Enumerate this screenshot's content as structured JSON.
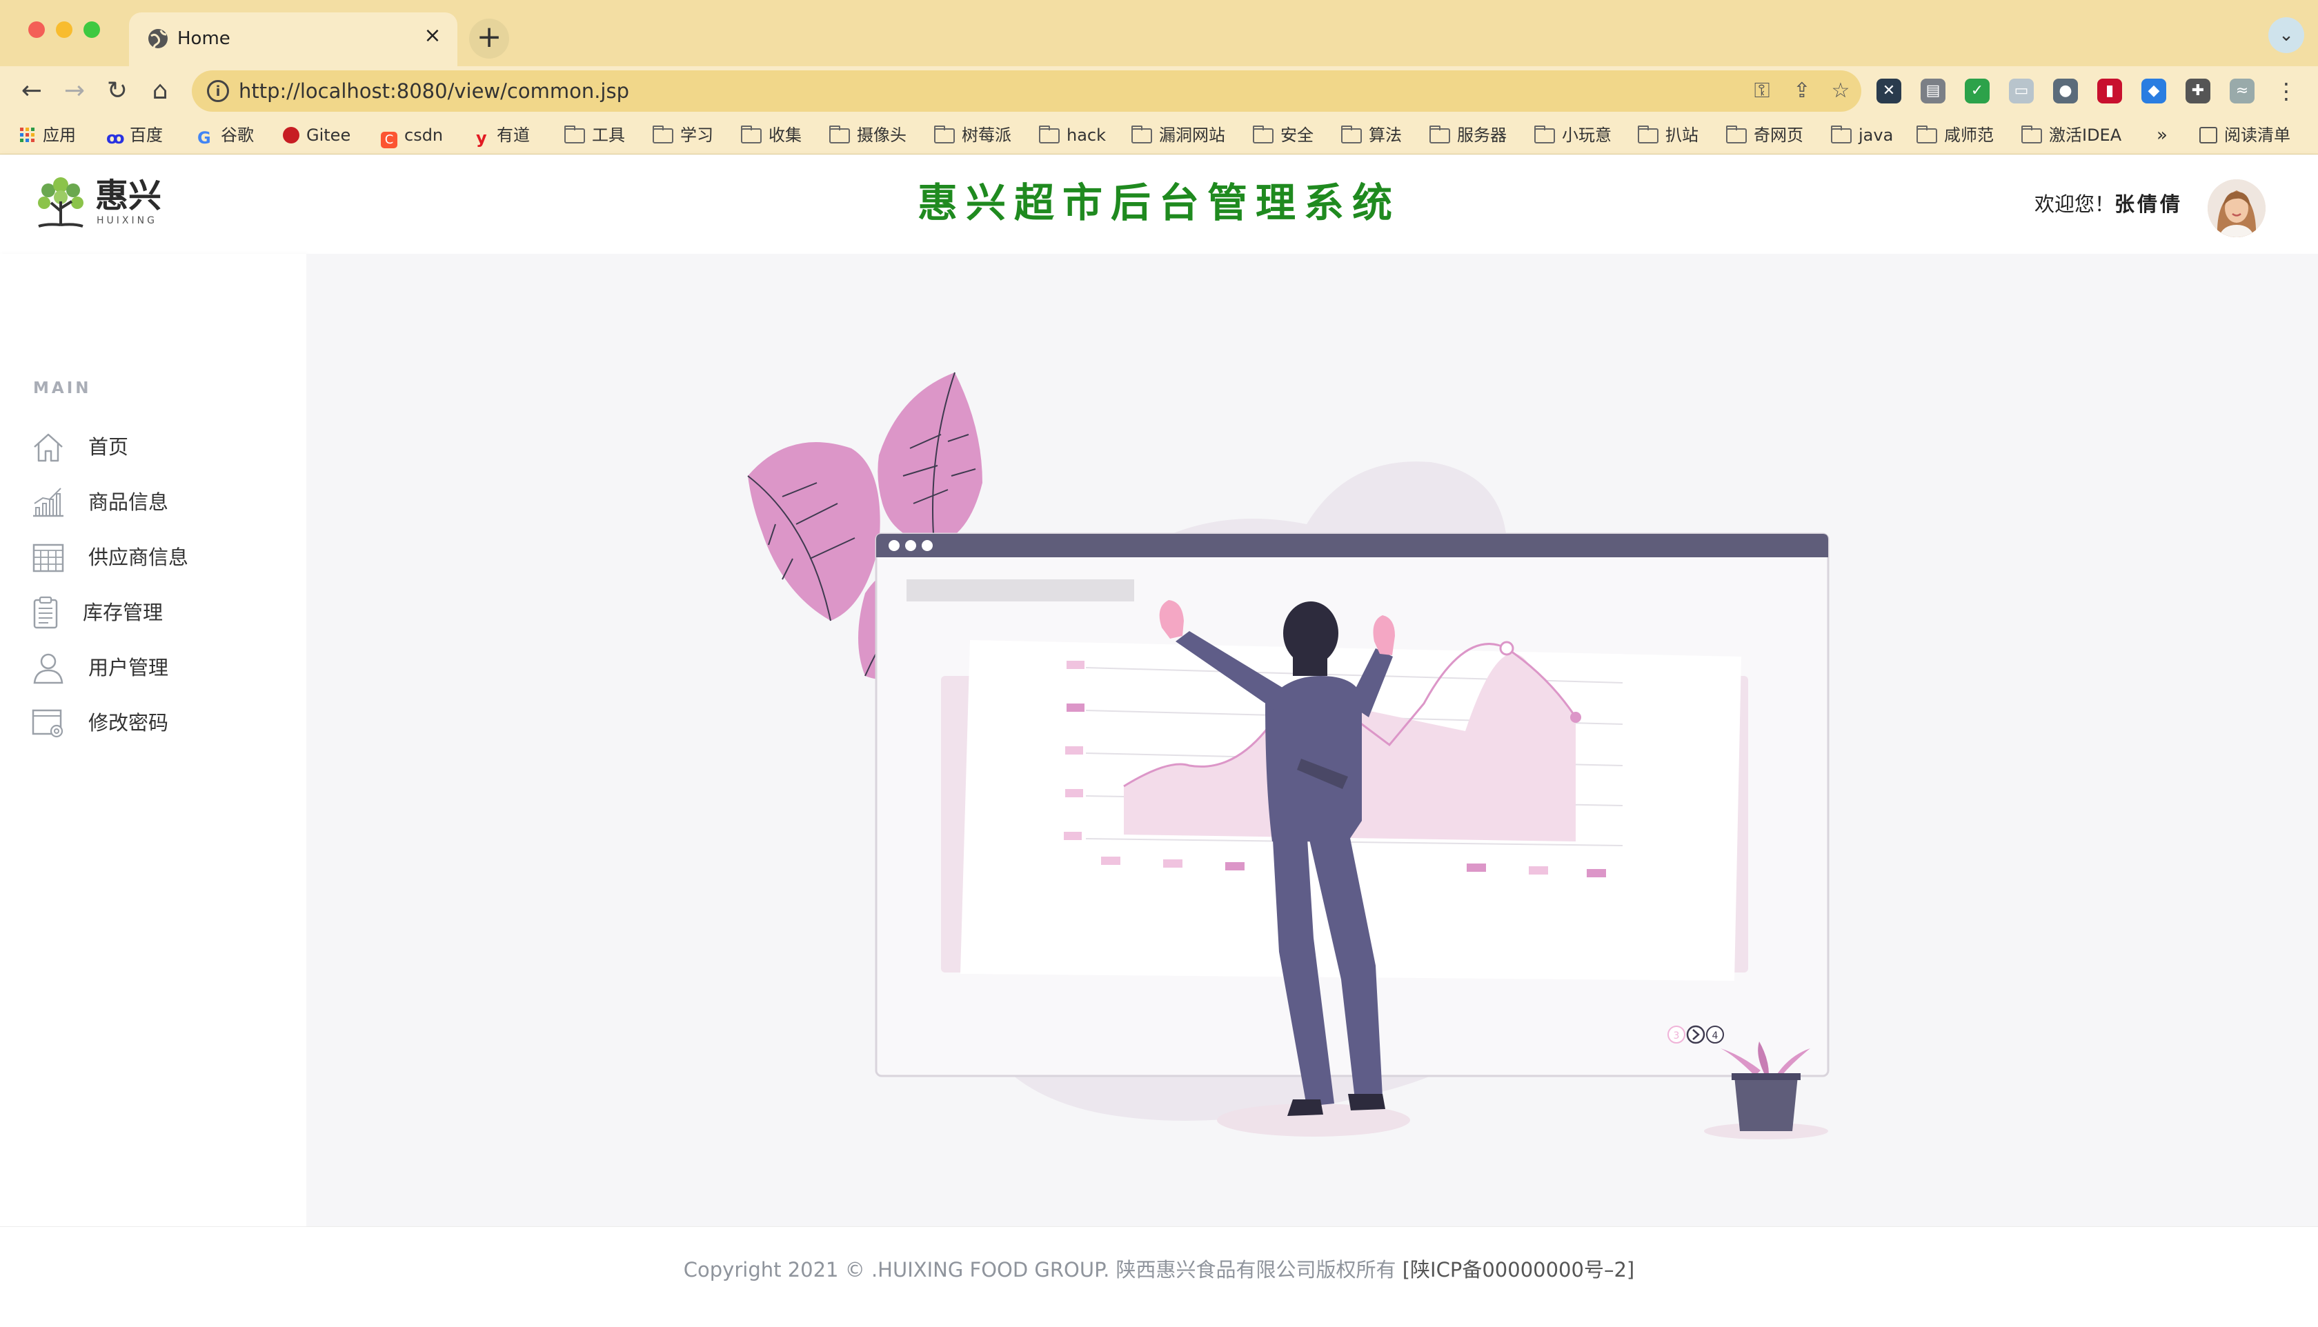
{
  "browser": {
    "tab_title": "Home",
    "tab_close": "×",
    "new_tab": "+",
    "tab_list": "⌄",
    "url": "http://localhost:8080/view/common.jsp",
    "bookmarks": [
      "应用",
      "百度",
      "谷歌",
      "Gitee",
      "csdn",
      "有道",
      "工具",
      "学习",
      "收集",
      "摄像头",
      "树莓派",
      "hack",
      "漏洞网站",
      "安全",
      "算法",
      "服务器",
      "小玩意",
      "扒站",
      "奇网页",
      "java",
      "咸师范",
      "激活IDEA"
    ],
    "overflow": "»",
    "reading_list": "阅读清单"
  },
  "header": {
    "logo_cn": "惠兴",
    "logo_en": "HUIXING",
    "title": "惠兴超市后台管理系统",
    "welcome_prefix": "欢迎您！",
    "user_name": "张倩倩"
  },
  "sidebar": {
    "section": "MAIN",
    "items": [
      {
        "label": "首页",
        "icon": "home-icon"
      },
      {
        "label": "商品信息",
        "icon": "chart-icon"
      },
      {
        "label": "供应商信息",
        "icon": "calendar-grid-icon"
      },
      {
        "label": "库存管理",
        "icon": "clipboard-icon"
      },
      {
        "label": "用户管理",
        "icon": "user-icon"
      },
      {
        "label": "修改密码",
        "icon": "window-gear-icon"
      }
    ]
  },
  "illustration": {
    "pager": [
      "3",
      "4"
    ]
  },
  "footer": {
    "copyright": "Copyright 2021 © .HUIXING FOOD GROUP. 陕西惠兴食品有限公司版权所有",
    "icp": "[陕ICP备00000000号–2]"
  },
  "colors": {
    "accent_green": "#1f8a1f",
    "chrome": "#f3dea3",
    "illustration_pink": "#dc96c8",
    "illustration_navy": "#5f5d88"
  }
}
